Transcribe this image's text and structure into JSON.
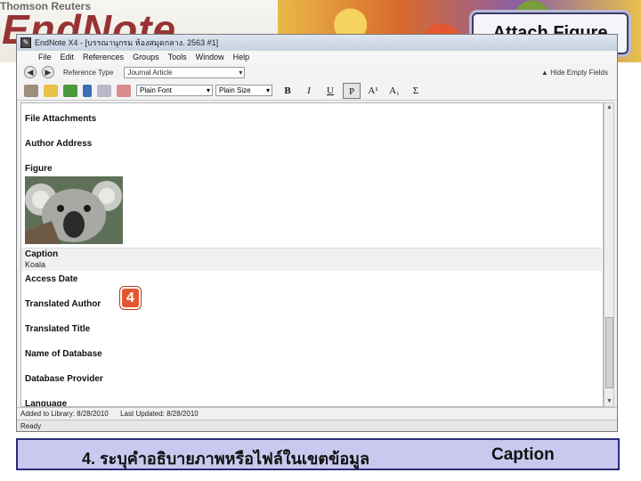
{
  "banner": {
    "brand_top": "Thomson Reuters",
    "brand_logo": "EndNote",
    "attach_title": "Attach Figure"
  },
  "window": {
    "title": "EndNote X4 - [บรรณานุกรม ห้องสมุดกลาง. 2563 #1]",
    "menu": [
      "File",
      "Edit",
      "References",
      "Groups",
      "Tools",
      "Window",
      "Help"
    ],
    "reference_type_label": "Reference Type",
    "reference_type_value": "Journal Article",
    "hide_fields": "Hide Empty Fields",
    "font_select": "Plain Font",
    "size_select": "Plain Size",
    "format_buttons": [
      "B",
      "I",
      "U",
      "P",
      "A¹",
      "A₁",
      "Σ"
    ]
  },
  "fields": {
    "file_attachments": "File Attachments",
    "author_address": "Author Address",
    "figure": "Figure",
    "caption": "Caption",
    "caption_value": "Koala",
    "access_date": "Access Date",
    "translated_author": "Translated Author",
    "translated_title": "Translated Title",
    "name_of_database": "Name of Database",
    "database_provider": "Database Provider",
    "language": "Language"
  },
  "status": {
    "added": "Added to Library: 8/28/2010",
    "updated": "Last Updated: 8/28/2010",
    "ready": "Ready"
  },
  "badge": "4",
  "bottom": {
    "thai": "4. ระบุคำอธิบายภาพหรือไฟล์ในเขตข้อมูล",
    "caption": "Caption"
  },
  "colors": {
    "accent_badge": "#e4572e",
    "bottom_bg": "#c9c9ef",
    "bottom_border": "#2b2b7a"
  }
}
